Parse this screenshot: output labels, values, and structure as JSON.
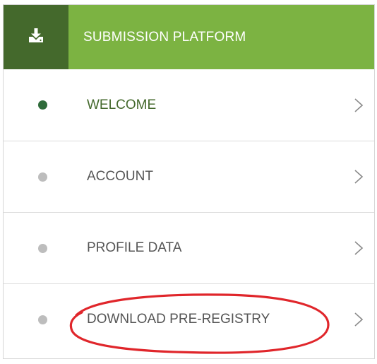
{
  "header": {
    "title": "SUBMISSION PLATFORM",
    "icon": "download-icon",
    "icon_box_color": "#44692c",
    "title_bar_color": "#7cb342"
  },
  "nav": {
    "items": [
      {
        "label": "WELCOME",
        "status": "active",
        "dot_color": "#2f6b3a"
      },
      {
        "label": "ACCOUNT",
        "status": "inactive",
        "dot_color": "#bdbdbd"
      },
      {
        "label": "PROFILE DATA",
        "status": "inactive",
        "dot_color": "#bdbdbd"
      },
      {
        "label": "DOWNLOAD PRE-REGISTRY",
        "status": "inactive",
        "dot_color": "#bdbdbd",
        "highlighted": true
      }
    ]
  },
  "annotation": {
    "color": "#e0262b"
  }
}
